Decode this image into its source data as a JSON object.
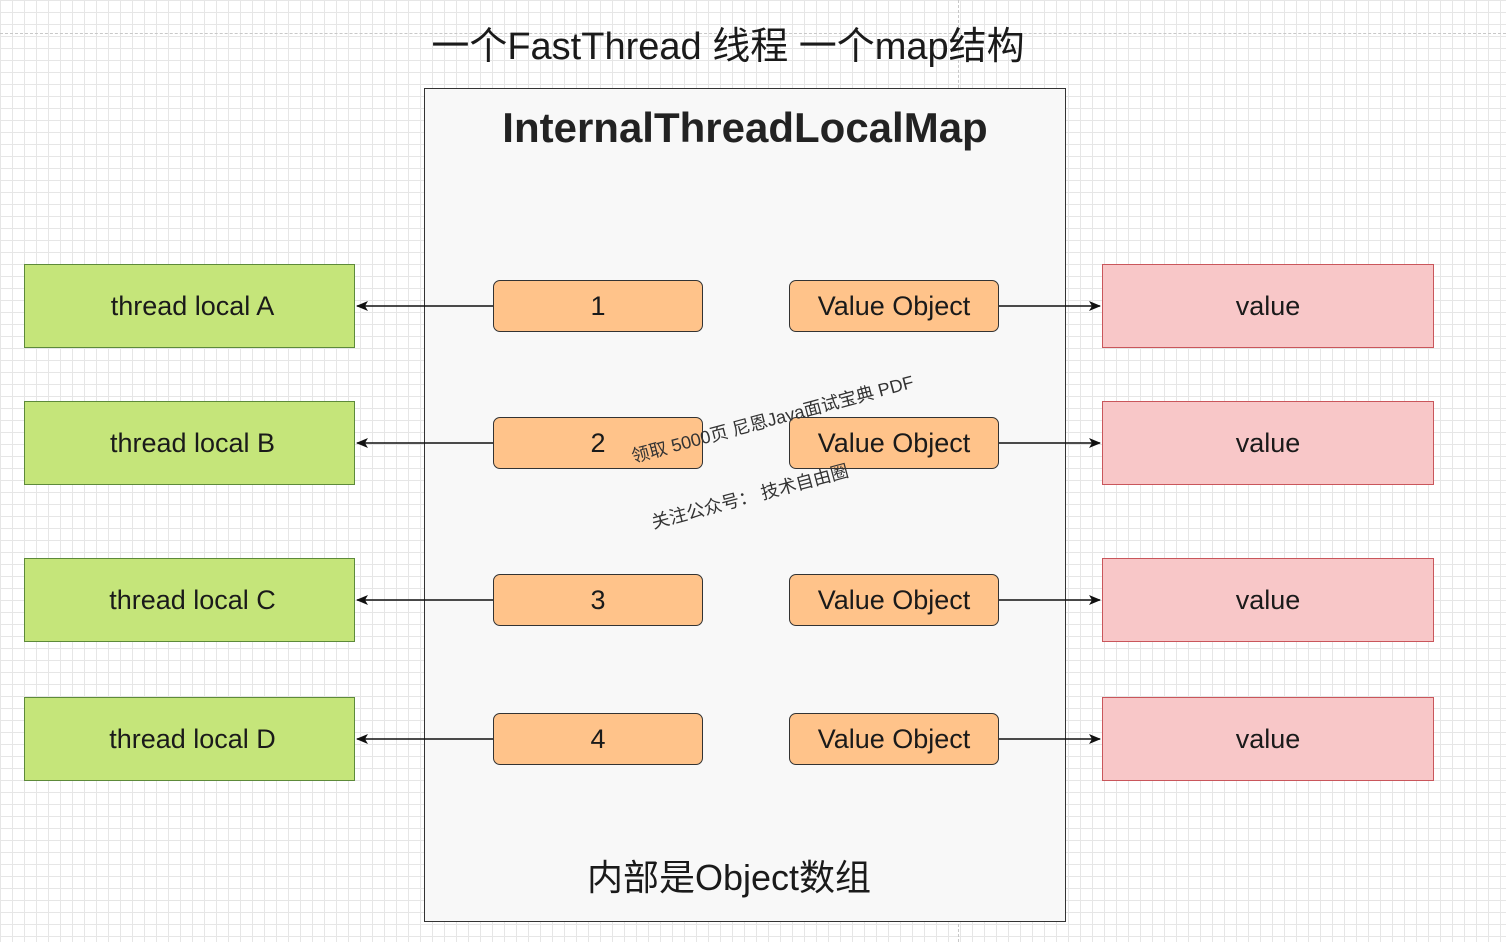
{
  "title": "一个FastThread  线程 一个map结构",
  "map": {
    "title": "InternalThreadLocalMap",
    "footer": "内部是Object数组"
  },
  "thread_locals": [
    {
      "label": "thread local A"
    },
    {
      "label": "thread local B"
    },
    {
      "label": "thread local C"
    },
    {
      "label": "thread local D"
    }
  ],
  "keys": [
    {
      "label": "1"
    },
    {
      "label": "2"
    },
    {
      "label": "3"
    },
    {
      "label": "4"
    }
  ],
  "value_objects": [
    {
      "label": "Value Object"
    },
    {
      "label": "Value Object"
    },
    {
      "label": "Value Object"
    },
    {
      "label": "Value Object"
    }
  ],
  "values": [
    {
      "label": "value"
    },
    {
      "label": "value"
    },
    {
      "label": "value"
    },
    {
      "label": "value"
    }
  ],
  "watermark": {
    "line1": "领取 5000页 尼恩Java面试宝典 PDF",
    "line2": "关注公众号： 技术自由圈"
  },
  "colors": {
    "thread_local_fill": "#c5e57a",
    "key_fill": "#ffc38a",
    "value_fill": "#f8c7c8"
  }
}
